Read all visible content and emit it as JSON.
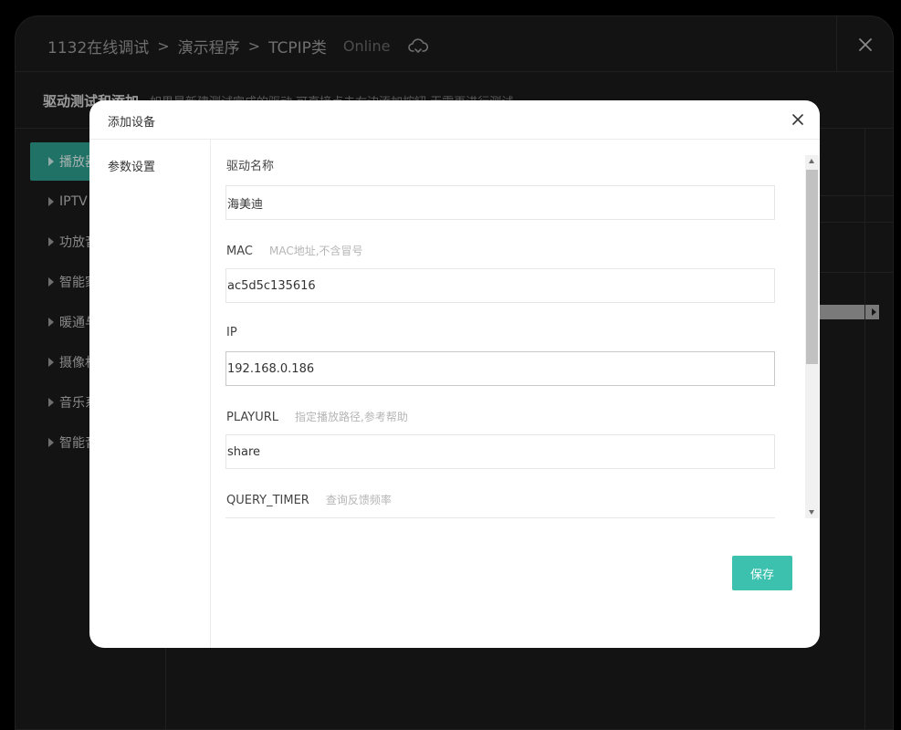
{
  "header": {
    "breadcrumbs": [
      "1132在线调试",
      "演示程序",
      "TCPIP类"
    ],
    "separator": ">",
    "status": "Online",
    "cloud_icon": "cloud-sync-icon",
    "close_icon": "close-icon"
  },
  "subheader": {
    "title": "驱动测试和添加",
    "description": "如果是新建测试完成的驱动,可直接点击右边添加按钮,无需再进行测试"
  },
  "sidebar": {
    "items": [
      {
        "label": "播放器",
        "active": true
      },
      {
        "label": "IPTV",
        "active": false
      },
      {
        "label": "功放音",
        "active": false
      },
      {
        "label": "智能家",
        "active": false
      },
      {
        "label": "暖通与",
        "active": false
      },
      {
        "label": "摄像机",
        "active": false
      },
      {
        "label": "音乐系",
        "active": false
      },
      {
        "label": "智能音",
        "active": false
      }
    ]
  },
  "dialog": {
    "title": "添加设备",
    "close_icon": "close-icon",
    "left_menu": [
      "参数设置"
    ],
    "fields": [
      {
        "label": "驱动名称",
        "hint": "",
        "value": "海美迪"
      },
      {
        "label": "MAC",
        "hint": "MAC地址,不含冒号",
        "value": "ac5d5c135616"
      },
      {
        "label": "IP",
        "hint": "",
        "value": "192.168.0.186"
      },
      {
        "label": "PLAYURL",
        "hint": "指定播放路径,参考帮助",
        "value": "share"
      },
      {
        "label": "QUERY_TIMER",
        "hint": "查询反馈频率",
        "value": ""
      }
    ],
    "save_label": "保存"
  },
  "colors": {
    "accent": "#3bc1ae",
    "sidebar_active": "#2d9e8e",
    "background": "#1b1b1b"
  }
}
